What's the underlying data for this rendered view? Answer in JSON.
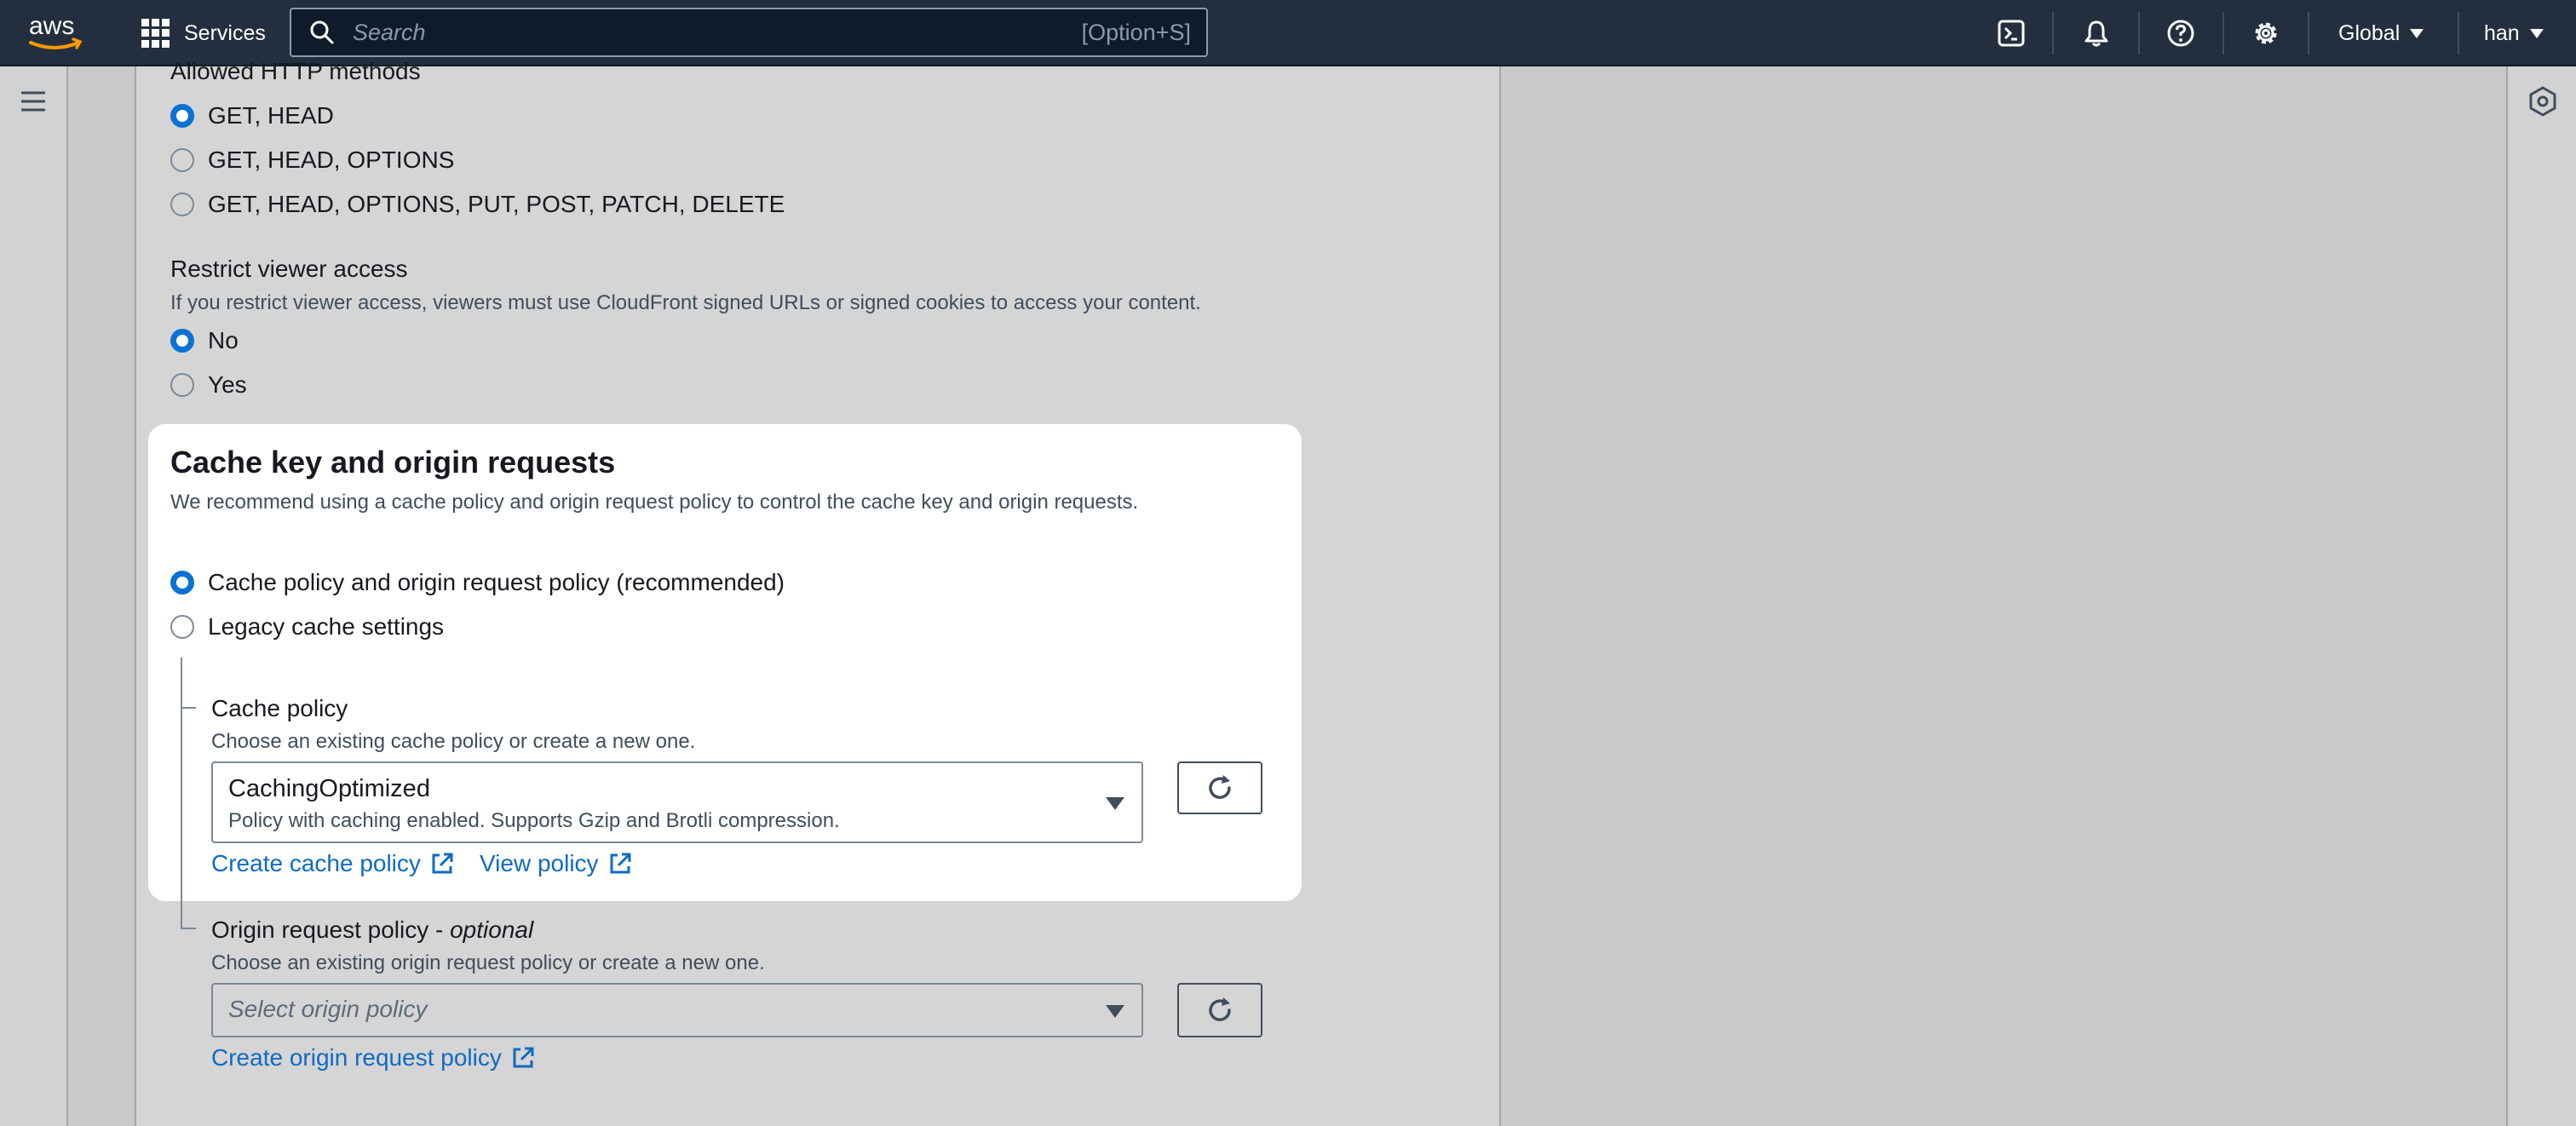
{
  "nav": {
    "services_label": "Services",
    "search_placeholder": "Search",
    "search_shortcut": "[Option+S]",
    "region_label": "Global",
    "user_label": "han"
  },
  "allowed_methods": {
    "title": "Allowed HTTP methods",
    "options": [
      {
        "label": "GET, HEAD",
        "selected": true
      },
      {
        "label": "GET, HEAD, OPTIONS",
        "selected": false
      },
      {
        "label": "GET, HEAD, OPTIONS, PUT, POST, PATCH, DELETE",
        "selected": false
      }
    ]
  },
  "restrict_access": {
    "title": "Restrict viewer access",
    "description": "If you restrict viewer access, viewers must use CloudFront signed URLs or signed cookies to access your content.",
    "options": [
      {
        "label": "No",
        "selected": true
      },
      {
        "label": "Yes",
        "selected": false
      }
    ]
  },
  "cache_key": {
    "title": "Cache key and origin requests",
    "description": "We recommend using a cache policy and origin request policy to control the cache key and origin requests.",
    "options": [
      {
        "label": "Cache policy and origin request policy (recommended)",
        "selected": true
      },
      {
        "label": "Legacy cache settings",
        "selected": false
      }
    ]
  },
  "cache_policy": {
    "title": "Cache policy",
    "description": "Choose an existing cache policy or create a new one.",
    "selected_value": "CachingOptimized",
    "selected_description": "Policy with caching enabled. Supports Gzip and Brotli compression.",
    "create_link": "Create cache policy",
    "view_link": "View policy"
  },
  "origin_request_policy": {
    "title": "Origin request policy - ",
    "title_suffix": "optional",
    "description": "Choose an existing origin request policy or create a new one.",
    "placeholder": "Select origin policy",
    "create_link": "Create origin request policy"
  },
  "colors": {
    "nav_bg": "#232f3e",
    "accent": "#0972d3",
    "link": "#0f6bc2"
  }
}
